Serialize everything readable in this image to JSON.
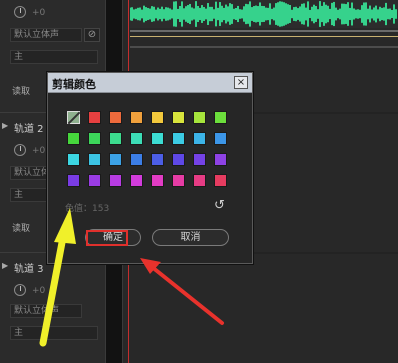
{
  "tracks": [
    {
      "volume": "+0",
      "input": "默认立体声",
      "output": "主",
      "read": "读取"
    },
    {
      "name": "轨道 2",
      "volume": "+0",
      "input": "默认立体声",
      "output": "主",
      "read": "读取"
    },
    {
      "name": "轨道 3",
      "volume": "+0",
      "input": "默认立体声",
      "output": "主"
    }
  ],
  "dialog": {
    "title": "剪辑颜色",
    "close_label": "×",
    "value_label": "色值：153",
    "ok_label": "确定",
    "cancel_label": "取消",
    "swatch_rows": [
      [
        "none",
        "#e64040",
        "#ee6a3c",
        "#f0a03c",
        "#f2c83c",
        "#d8e43c",
        "#a6e43c",
        "#6cde3c"
      ],
      [
        "#46d63c",
        "#3cd65a",
        "#3cdc8e",
        "#3cdcb6",
        "#3cdcd2",
        "#3ccce4",
        "#3cb4e8",
        "#3c96e8"
      ],
      [
        "#3cd6e2",
        "#3cc4e4",
        "#3ca2e6",
        "#3c7ee6",
        "#4c5ee6",
        "#5e48e6",
        "#7442e6",
        "#8e42e4"
      ],
      [
        "#7a3ce4",
        "#9a3ce4",
        "#b83ce2",
        "#d23cdc",
        "#e23cc4",
        "#e63ca4",
        "#e63c84",
        "#e63c60"
      ]
    ]
  },
  "colors": {
    "waveform": "#36d28c",
    "playhead": "#c42d2d",
    "yellow_arrow": "#f0f02a",
    "red_arrow": "#e8322c"
  },
  "icons": {
    "reset": "↺",
    "expand": "▶",
    "circle_slash": "⊘"
  }
}
